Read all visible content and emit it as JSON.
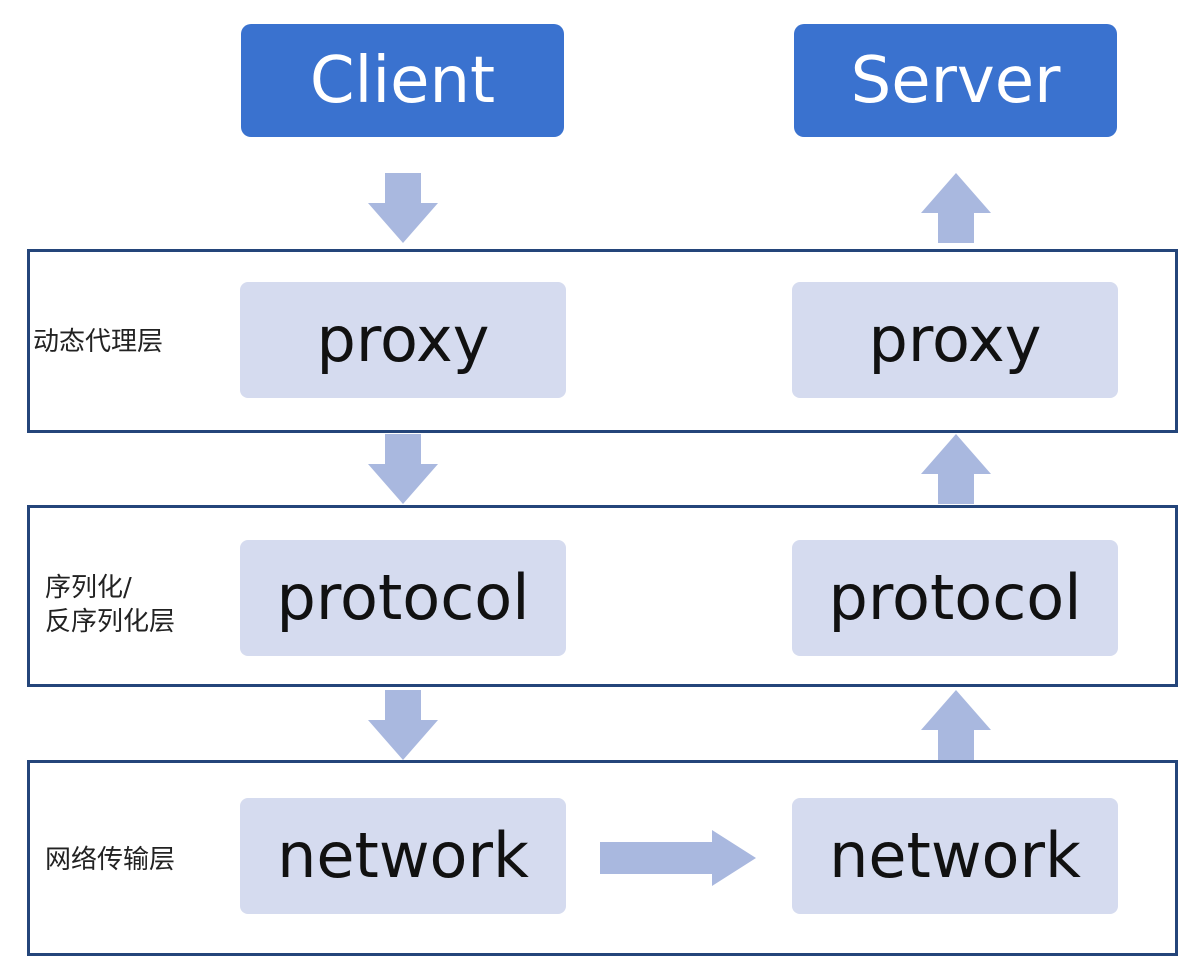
{
  "endpoints": {
    "client": "Client",
    "server": "Server"
  },
  "layers": [
    {
      "label": "动态代理层",
      "component": "proxy"
    },
    {
      "label_line1": "序列化/",
      "label_line2": "反序列化层",
      "component": "protocol"
    },
    {
      "label": "网络传输层",
      "component": "network"
    }
  ],
  "colors": {
    "endpoint": "#3a72cf",
    "component": "#d5dbef",
    "frame": "#24457a",
    "arrow": "#a9b8df"
  },
  "arrows": {
    "client_side": "down-arrow",
    "server_side": "up-arrow",
    "network": "right-arrow"
  }
}
